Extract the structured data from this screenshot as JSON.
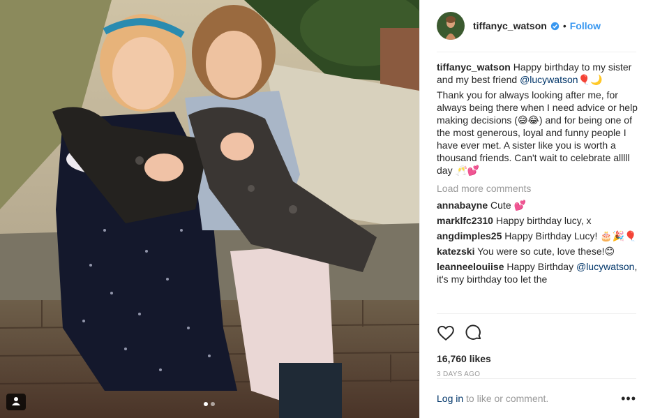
{
  "post": {
    "username": "tiffanyc_watson",
    "separator": "•",
    "follow_label": "Follow",
    "caption": {
      "author": "tiffanyc_watson",
      "line1_pre": "Happy birthday to my sister and my best friend ",
      "mention": "@lucywatson",
      "line1_emoji": "🎈🌙",
      "para2": "Thank you for always looking after me, for always being there when I need advice or help making decisions (😅😂) and for being one of the most generous, loyal and funny people I have ever met. A sister like you is worth a thousand friends. Can't wait to celebrate alllll day 🥂💕"
    },
    "load_more_label": "Load more comments",
    "comments": [
      {
        "user": "annabayne",
        "text": "Cute 💕"
      },
      {
        "user": "marklfc2310",
        "text": "Happy birthday lucy, x"
      },
      {
        "user": "angdimples25",
        "text": "Happy Birthday Lucy! 🎂🎉🎈"
      },
      {
        "user": "katezski",
        "text": "You were so cute, love these!😊"
      },
      {
        "user": "leanneelouiise",
        "text_pre": "Happy Birthday ",
        "mention": "@lucywatson",
        "text_post": ", it's my birthday too let the"
      }
    ],
    "likes": "16,760 likes",
    "date": "3 DAYS AGO",
    "footer": {
      "login_label": "Log in",
      "login_suffix": " to like or comment.",
      "more_label": "•••"
    },
    "carousel": {
      "count": 2,
      "active": 1
    },
    "icons": {
      "like": "heart-icon",
      "comment": "comment-icon",
      "verified": "verified-badge-icon",
      "tag": "user-tag-icon",
      "more": "more-options-icon"
    },
    "colors": {
      "link": "#3897f0",
      "mention": "#003569",
      "muted": "#999999",
      "text": "#262626"
    }
  }
}
